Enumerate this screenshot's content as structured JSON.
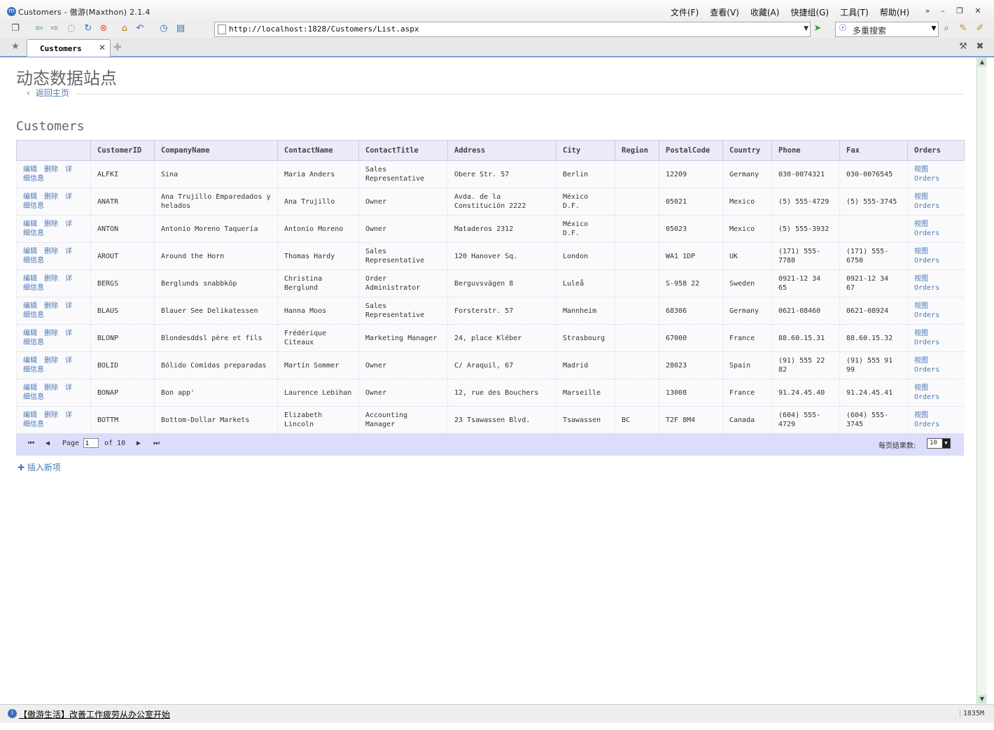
{
  "window": {
    "title": "Customers - 傲游(Maxthon) 2.1.4",
    "menu": [
      "文件(F)",
      "查看(V)",
      "收藏(A)",
      "快捷组(G)",
      "工具(T)",
      "帮助(H)"
    ]
  },
  "toolbar": {
    "address": "http://localhost:1828/Customers/List.aspx",
    "search_engine": "多重搜索"
  },
  "tabs": {
    "active_label": "Customers"
  },
  "page": {
    "site_title": "动态数据站点",
    "back_link": "返回主页",
    "table_title": "Customers",
    "insert_link": "插入新项"
  },
  "grid": {
    "columns": [
      "",
      "CustomerID",
      "CompanyName",
      "ContactName",
      "ContactTitle",
      "Address",
      "City",
      "Region",
      "PostalCode",
      "Country",
      "Phone",
      "Fax",
      "Orders"
    ],
    "action_labels": {
      "edit": "编辑",
      "delete": "删除",
      "details_1": "详",
      "details_2": "细信息"
    },
    "orders_link": {
      "line1": "视图",
      "line2": "Orders"
    },
    "rows": [
      [
        "ALFKI",
        "Sina",
        "Maria Anders",
        "Sales Representative",
        "Obere Str. 57",
        "Berlin",
        "",
        "12209",
        "Germany",
        "030-0074321",
        "030-0076545"
      ],
      [
        "ANATR",
        "Ana Trujillo Emparedados y helados",
        "Ana Trujillo",
        "Owner",
        "Avda. de la Constitución 2222",
        "México D.F.",
        "",
        "05021",
        "Mexico",
        "(5) 555-4729",
        "(5) 555-3745"
      ],
      [
        "ANTON",
        "Antonio Moreno Taquería",
        "Antonio Moreno",
        "Owner",
        "Mataderos 2312",
        "México D.F.",
        "",
        "05023",
        "Mexico",
        "(5) 555-3932",
        ""
      ],
      [
        "AROUT",
        "Around the Horn",
        "Thomas Hardy",
        "Sales Representative",
        "120 Hanover Sq.",
        "London",
        "",
        "WA1 1DP",
        "UK",
        "(171) 555-7788",
        "(171) 555-6750"
      ],
      [
        "BERGS",
        "Berglunds snabbköp",
        "Christina Berglund",
        "Order Administrator",
        "Berguvsvägen 8",
        "Luleå",
        "",
        "S-958 22",
        "Sweden",
        "0921-12 34 65",
        "0921-12 34 67"
      ],
      [
        "BLAUS",
        "Blauer See Delikatessen",
        "Hanna Moos",
        "Sales Representative",
        "Forsterstr. 57",
        "Mannheim",
        "",
        "68306",
        "Germany",
        "0621-08460",
        "0621-08924"
      ],
      [
        "BLONP",
        "Blondesddsl père et fils",
        "Frédérique Citeaux",
        "Marketing Manager",
        "24, place Kléber",
        "Strasbourg",
        "",
        "67000",
        "France",
        "88.60.15.31",
        "88.60.15.32"
      ],
      [
        "BOLID",
        "Bólido Comidas preparadas",
        "Martín Sommer",
        "Owner",
        "C/ Araquil, 67",
        "Madrid",
        "",
        "28023",
        "Spain",
        "(91) 555 22 82",
        "(91) 555 91 99"
      ],
      [
        "BONAP",
        "Bon app'",
        "Laurence Lebihan",
        "Owner",
        "12, rue des Bouchers",
        "Marseille",
        "",
        "13008",
        "France",
        "91.24.45.40",
        "91.24.45.41"
      ],
      [
        "BOTTM",
        "Bottom-Dollar Markets",
        "Elizabeth Lincoln",
        "Accounting Manager",
        "23 Tsawassen Blvd.",
        "Tsawassen",
        "BC",
        "T2F 8M4",
        "Canada",
        "(604) 555-4729",
        "(604) 555-3745"
      ]
    ]
  },
  "pager": {
    "page_label": "Page",
    "current_page": "1",
    "of_label": "of 10",
    "page_size_label": "每页结果数:",
    "page_size": "10"
  },
  "status": {
    "text": "【傲游生活】改善工作疲劳从办公室开始",
    "memory": "1835M"
  },
  "colors": {
    "link": "#4a78b5",
    "header_bg": "#eaeaf8",
    "pager_bg": "#dcdcfb"
  }
}
